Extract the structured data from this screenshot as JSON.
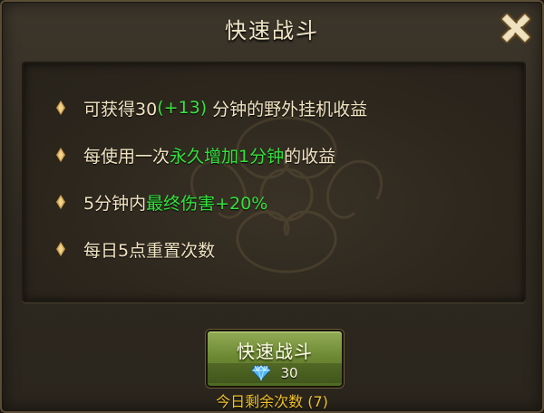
{
  "dialog": {
    "title": "快速战斗",
    "close_icon": "close-x-icon"
  },
  "benefits": [
    {
      "parts": [
        "可获得30",
        "(+13)",
        "分钟的野外挂机收益"
      ]
    },
    {
      "parts": [
        "每使用一次",
        "永久增加1分钟",
        "的收益"
      ]
    },
    {
      "parts": [
        "5分钟内",
        "最终伤害+20%"
      ]
    },
    {
      "parts": [
        "每日5点重置次数"
      ]
    }
  ],
  "quick_fight_button": {
    "label": "快速战斗",
    "cost_icon": "diamond-icon",
    "cost": "30"
  },
  "remaining_today": "今日剩余次数 (7)",
  "colors": {
    "highlight_green": "#33e23c",
    "remaining_gold": "#f2c32a",
    "text_cream": "#f2e4c2"
  }
}
